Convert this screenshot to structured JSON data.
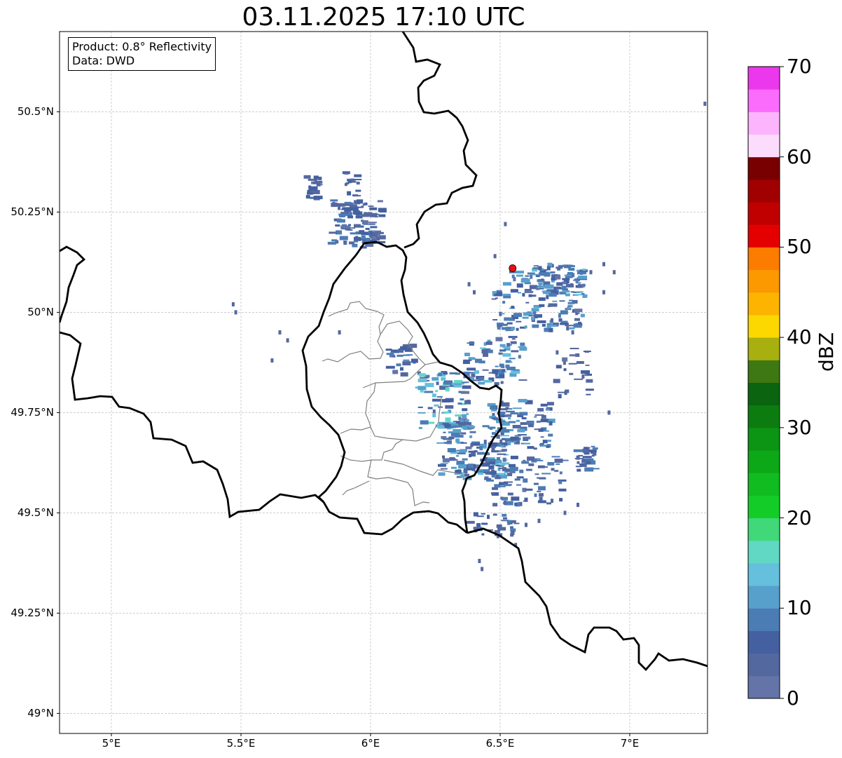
{
  "title": "03.11.2025 17:10 UTC",
  "info": {
    "product": "Product: 0.8° Reflectivity",
    "data": "Data: DWD"
  },
  "map_extent": {
    "lon": [
      4.8,
      7.3
    ],
    "lat": [
      48.95,
      50.7
    ]
  },
  "y_ticks": [
    {
      "lat": 50.5,
      "label": "50.5°N"
    },
    {
      "lat": 50.25,
      "label": "50.25°N"
    },
    {
      "lat": 50.0,
      "label": "50°N"
    },
    {
      "lat": 49.75,
      "label": "49.75°N"
    },
    {
      "lat": 49.5,
      "label": "49.5°N"
    },
    {
      "lat": 49.25,
      "label": "49.25°N"
    },
    {
      "lat": 49.0,
      "label": "49°N"
    }
  ],
  "x_ticks": [
    {
      "lon": 5.0,
      "label": "5°E"
    },
    {
      "lon": 5.5,
      "label": "5.5°E"
    },
    {
      "lon": 6.0,
      "label": "6°E"
    },
    {
      "lon": 6.5,
      "label": "6.5°E"
    },
    {
      "lon": 7.0,
      "label": "7°E"
    }
  ],
  "radar_site": {
    "lon": 6.548,
    "lat": 50.11,
    "color": "#e81010"
  },
  "colorbar": {
    "unit": "dBZ",
    "min": 0,
    "max": 70,
    "tick_labels": [
      "0",
      "10",
      "20",
      "30",
      "40",
      "50",
      "60",
      "70"
    ],
    "colors": [
      "#6474a8",
      "#5468a0",
      "#4460a0",
      "#4c7cb4",
      "#58a0cc",
      "#64c0dc",
      "#60d8c4",
      "#40d878",
      "#14cc28",
      "#10bc20",
      "#0ca818",
      "#0c9414",
      "#0c7c10",
      "#0a6410",
      "#3e7812",
      "#a8b010",
      "#fcd800",
      "#fcb400",
      "#fc9800",
      "#fc7c00",
      "#e40000",
      "#c00000",
      "#a00000",
      "#780000",
      "#fcdcfc",
      "#fcb4fc",
      "#fc6cfc",
      "#ec38ec"
    ]
  },
  "echo_clusters": [
    {
      "lon": 5.95,
      "lat": 50.22,
      "w": 0.2,
      "h": 0.12,
      "n": 110,
      "dbz": [
        2,
        9
      ]
    },
    {
      "lon": 5.78,
      "lat": 50.31,
      "w": 0.05,
      "h": 0.06,
      "n": 25,
      "dbz": [
        2,
        7
      ]
    },
    {
      "lon": 5.93,
      "lat": 50.32,
      "w": 0.05,
      "h": 0.06,
      "n": 15,
      "dbz": [
        2,
        7
      ]
    },
    {
      "lon": 6.65,
      "lat": 50.03,
      "w": 0.35,
      "h": 0.15,
      "n": 140,
      "dbz": [
        2,
        12
      ]
    },
    {
      "lon": 6.73,
      "lat": 50.08,
      "w": 0.2,
      "h": 0.08,
      "n": 70,
      "dbz": [
        2,
        14
      ]
    },
    {
      "lon": 6.48,
      "lat": 49.88,
      "w": 0.22,
      "h": 0.12,
      "n": 70,
      "dbz": [
        2,
        14
      ]
    },
    {
      "lon": 6.28,
      "lat": 49.78,
      "w": 0.2,
      "h": 0.14,
      "n": 90,
      "dbz": [
        2,
        16
      ]
    },
    {
      "lon": 6.4,
      "lat": 49.65,
      "w": 0.26,
      "h": 0.14,
      "n": 150,
      "dbz": [
        2,
        14
      ]
    },
    {
      "lon": 6.58,
      "lat": 49.72,
      "w": 0.24,
      "h": 0.12,
      "n": 90,
      "dbz": [
        2,
        12
      ]
    },
    {
      "lon": 6.6,
      "lat": 49.58,
      "w": 0.3,
      "h": 0.12,
      "n": 80,
      "dbz": [
        2,
        10
      ]
    },
    {
      "lon": 6.84,
      "lat": 49.64,
      "w": 0.08,
      "h": 0.07,
      "n": 30,
      "dbz": [
        2,
        9
      ]
    },
    {
      "lon": 6.47,
      "lat": 49.47,
      "w": 0.2,
      "h": 0.06,
      "n": 30,
      "dbz": [
        2,
        8
      ]
    },
    {
      "lon": 6.12,
      "lat": 49.88,
      "w": 0.1,
      "h": 0.08,
      "n": 25,
      "dbz": [
        2,
        10
      ]
    },
    {
      "lon": 6.78,
      "lat": 49.85,
      "w": 0.15,
      "h": 0.12,
      "n": 25,
      "dbz": [
        2,
        8
      ]
    }
  ],
  "echo_isolated": [
    [
      5.47,
      50.02
    ],
    [
      5.48,
      50.0
    ],
    [
      5.68,
      49.93
    ],
    [
      5.65,
      49.95
    ],
    [
      5.62,
      49.88
    ],
    [
      5.88,
      49.95
    ],
    [
      6.52,
      50.22
    ],
    [
      6.48,
      50.14
    ],
    [
      6.38,
      50.07
    ],
    [
      6.4,
      50.05
    ],
    [
      6.9,
      50.05
    ],
    [
      6.94,
      50.1
    ],
    [
      6.85,
      50.1
    ],
    [
      6.9,
      50.12
    ],
    [
      6.42,
      49.38
    ],
    [
      6.43,
      49.36
    ],
    [
      6.56,
      49.42
    ],
    [
      6.6,
      49.47
    ],
    [
      6.82,
      49.84
    ],
    [
      6.72,
      49.9
    ],
    [
      6.7,
      49.98
    ],
    [
      6.76,
      49.96
    ],
    [
      6.78,
      49.95
    ],
    [
      6.55,
      49.45
    ],
    [
      7.29,
      50.52
    ],
    [
      6.8,
      49.52
    ],
    [
      6.75,
      49.5
    ],
    [
      6.7,
      49.53
    ],
    [
      6.92,
      49.75
    ],
    [
      6.65,
      49.48
    ]
  ]
}
